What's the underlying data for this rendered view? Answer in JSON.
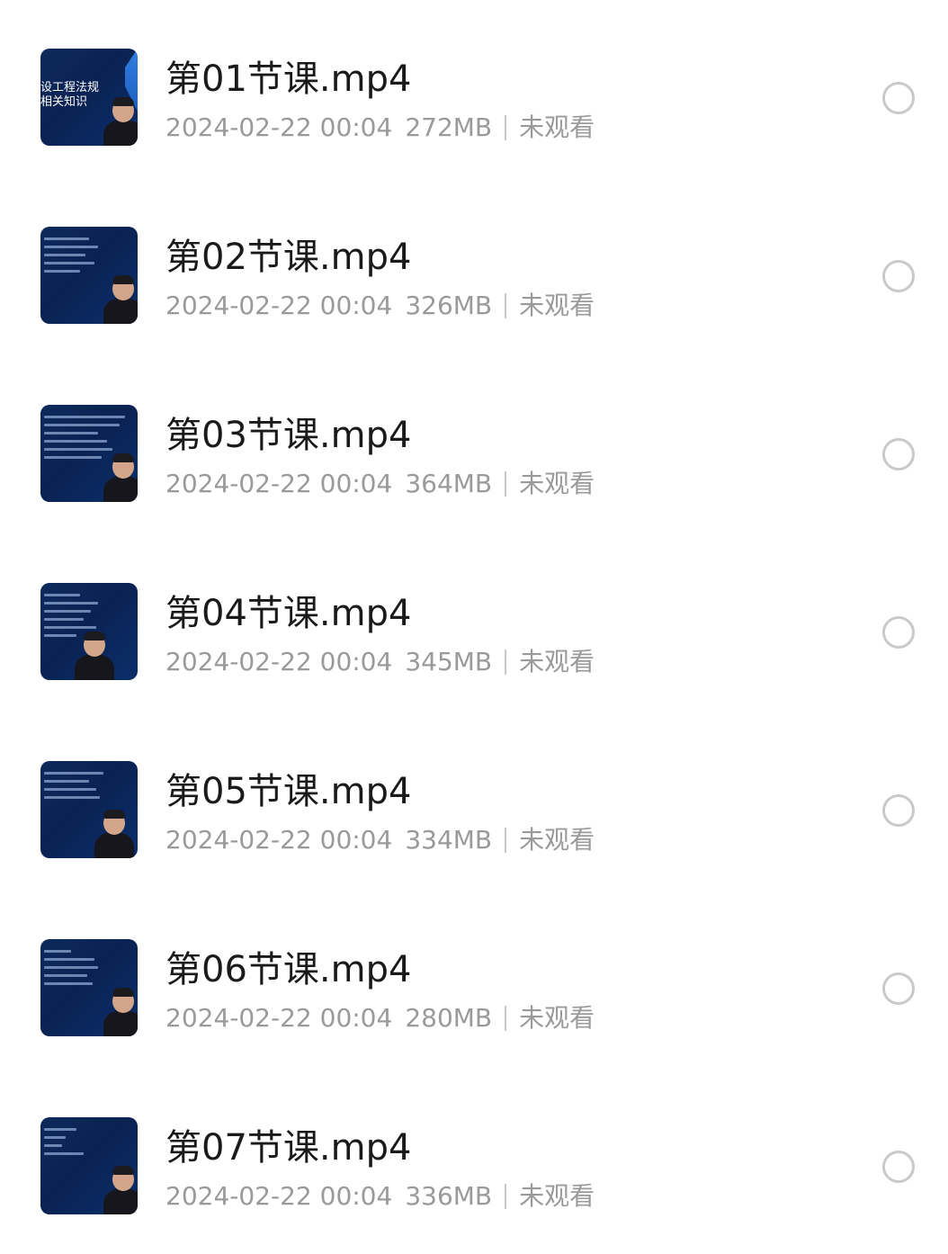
{
  "files": [
    {
      "name": "第01节课.mp4",
      "date": "2024-02-22 00:04",
      "size": "272MB",
      "status": "未观看",
      "thumb_text": "设工程法规\n相关知识"
    },
    {
      "name": "第02节课.mp4",
      "date": "2024-02-22 00:04",
      "size": "326MB",
      "status": "未观看"
    },
    {
      "name": "第03节课.mp4",
      "date": "2024-02-22 00:04",
      "size": "364MB",
      "status": "未观看"
    },
    {
      "name": "第04节课.mp4",
      "date": "2024-02-22 00:04",
      "size": "345MB",
      "status": "未观看"
    },
    {
      "name": "第05节课.mp4",
      "date": "2024-02-22 00:04",
      "size": "334MB",
      "status": "未观看"
    },
    {
      "name": "第06节课.mp4",
      "date": "2024-02-22 00:04",
      "size": "280MB",
      "status": "未观看"
    },
    {
      "name": "第07节课.mp4",
      "date": "2024-02-22 00:04",
      "size": "336MB",
      "status": "未观看"
    }
  ],
  "colors": {
    "title": "#1a1a1a",
    "meta": "#9a9a9a",
    "radio_border": "#c9c9c9",
    "thumb_bg": "#0a2253"
  },
  "icons": {
    "select": "radio-unchecked-icon"
  }
}
